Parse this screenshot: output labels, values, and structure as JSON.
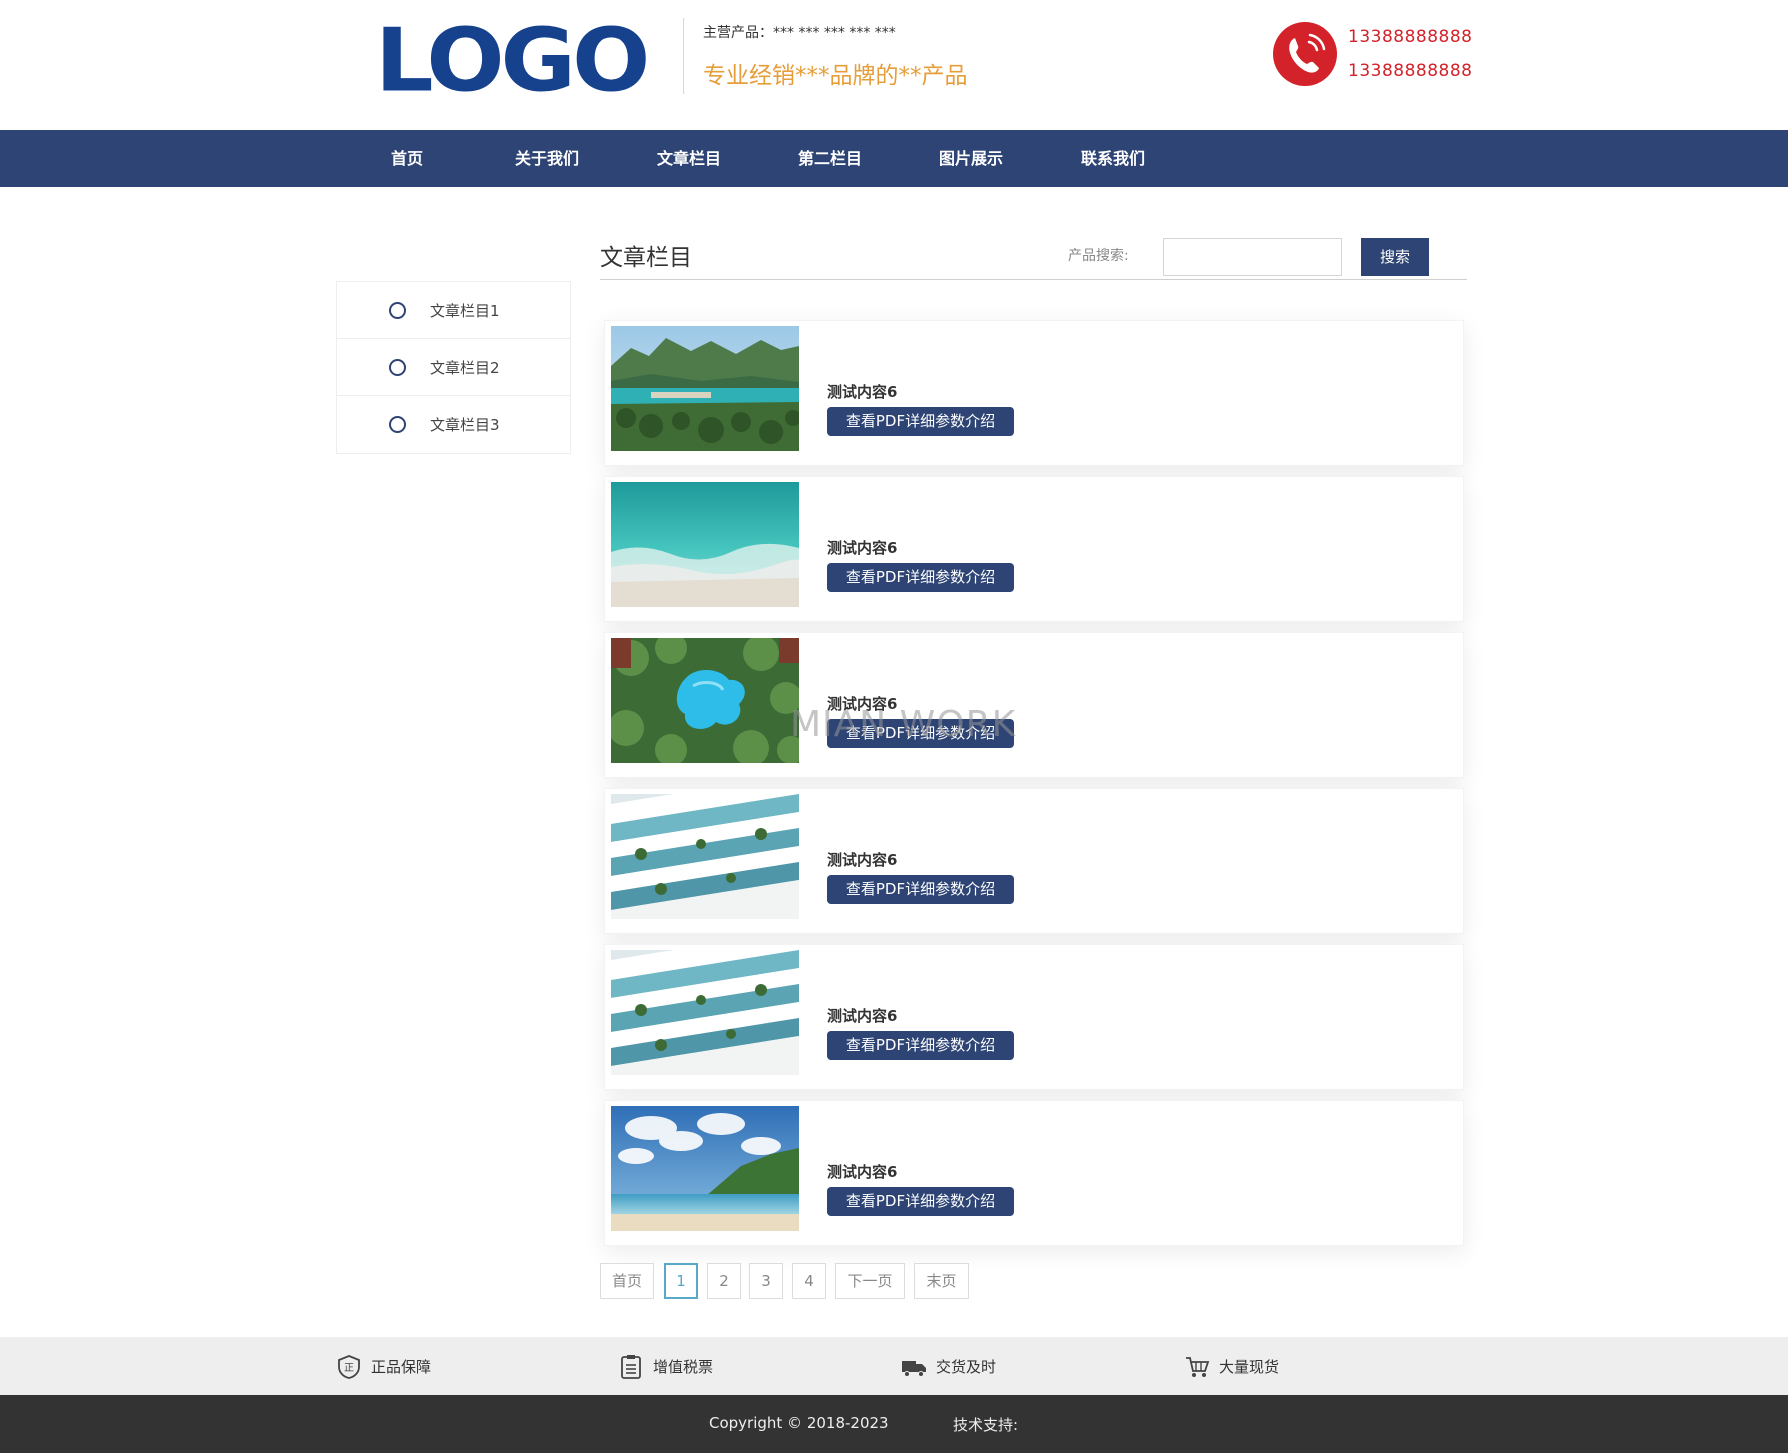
{
  "header": {
    "logo_text": "LOGO",
    "main_products": "主营产品：*** *** *** *** ***",
    "slogan": "专业经销***品牌的**产品",
    "phone_1": "13388888888",
    "phone_2": "13388888888",
    "phone_icon": "phone-icon"
  },
  "nav": {
    "items": [
      "首页",
      "关于我们",
      "文章栏目",
      "第二栏目",
      "图片展示",
      "联系我们"
    ]
  },
  "sidebar": {
    "items": [
      "文章栏目1",
      "文章栏目2",
      "文章栏目3"
    ]
  },
  "content": {
    "title": "文章栏目",
    "search_label": "产品搜索:",
    "search_value": "",
    "search_button": "搜索",
    "watermark": "MIAN WORK"
  },
  "articles": [
    {
      "title": "测试内容6",
      "button": "查看PDF详细参数介绍",
      "image": "tropical-bay-photo"
    },
    {
      "title": "测试内容6",
      "button": "查看PDF详细参数介绍",
      "image": "beach-waves-photo"
    },
    {
      "title": "测试内容6",
      "button": "查看PDF详细参数介绍",
      "image": "resort-pool-photo"
    },
    {
      "title": "测试内容6",
      "button": "查看PDF详细参数介绍",
      "image": "building-balconies-photo"
    },
    {
      "title": "测试内容6",
      "button": "查看PDF详细参数介绍",
      "image": "building-balconies-photo"
    },
    {
      "title": "测试内容6",
      "button": "查看PDF详细参数介绍",
      "image": "coast-sky-photo"
    }
  ],
  "pagination": {
    "first": "首页",
    "pages": [
      "1",
      "2",
      "3",
      "4"
    ],
    "current": "1",
    "next": "下一页",
    "last": "末页"
  },
  "features": [
    {
      "label": "正品保障",
      "icon": "shield-icon"
    },
    {
      "label": "增值税票",
      "icon": "invoice-icon"
    },
    {
      "label": "交货及时",
      "icon": "truck-icon"
    },
    {
      "label": "大量现货",
      "icon": "cart-icon"
    }
  ],
  "footer": {
    "copyright": "Copyright © 2018-2023",
    "support": "技术支持:"
  },
  "colors": {
    "brand_blue": "#2d4474",
    "logo_blue": "#16418c",
    "slogan_orange": "#e69e3a",
    "phone_red": "#d3222a",
    "active_page": "#58a9c8"
  }
}
